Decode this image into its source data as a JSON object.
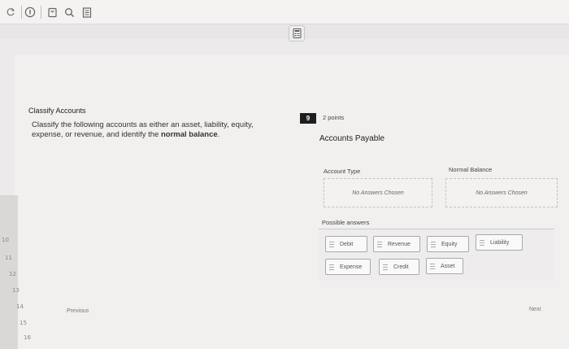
{
  "toolbar": {
    "icons": [
      "reload-icon",
      "info-icon",
      "bookmark-icon",
      "search-icon",
      "document-icon"
    ]
  },
  "calculator": {
    "icon": "calculator-icon"
  },
  "sidebar": {
    "question_numbers": [
      "10",
      "11",
      "12",
      "13",
      "14",
      "15",
      "16"
    ]
  },
  "question": {
    "title": "Classify Accounts",
    "instruction_prefix": "Classify the following accounts as either an asset, liability, equity, expense, or revenue, and identify the ",
    "instruction_bold": "normal balance",
    "instruction_suffix": ".",
    "number": "9",
    "points": "2 points",
    "account_name": "Accounts Payable"
  },
  "columns": {
    "account_type": {
      "header": "Account Type",
      "placeholder": "No Answers Chosen"
    },
    "normal_balance": {
      "header": "Normal Balance",
      "placeholder": "No Answers Chosen"
    }
  },
  "possible_answers": {
    "label": "Possible answers",
    "chips": [
      "Debit",
      "Revenue",
      "Equity",
      "Liability",
      "Expense",
      "Credit",
      "Asset"
    ]
  },
  "navigation": {
    "previous": "Previous",
    "next": "Next"
  }
}
